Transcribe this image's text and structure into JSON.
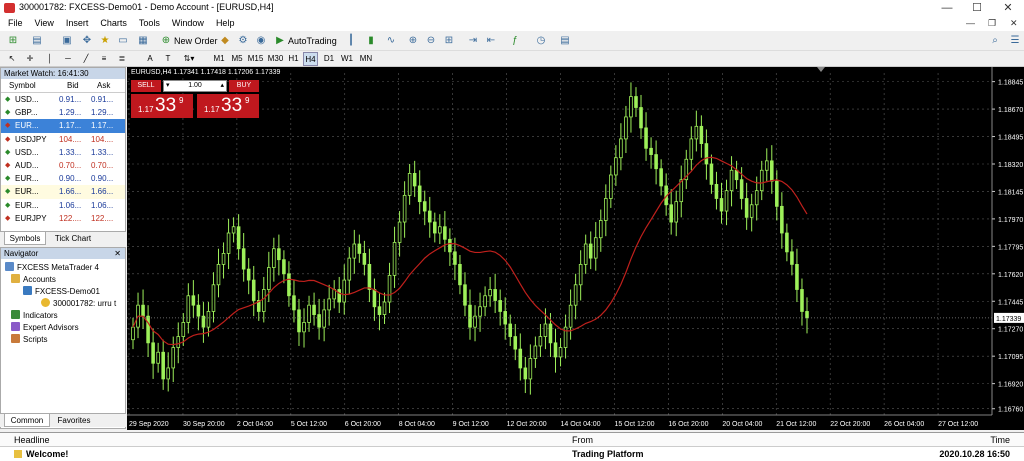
{
  "window": {
    "title": "300001782: FXCESS-Demo01 - Demo Account - [EURUSD,H4]",
    "controls": {
      "minimize": "—",
      "maximize": "☐",
      "close": "✕"
    }
  },
  "menu": [
    "File",
    "View",
    "Insert",
    "Charts",
    "Tools",
    "Window",
    "Help"
  ],
  "menu_right": {
    "minimize": "—",
    "restore": "❐",
    "close": "✕"
  },
  "toolbar": {
    "new_order": "New Order",
    "autotrading": "AutoTrading"
  },
  "timeframes": [
    "M1",
    "M5",
    "M15",
    "M30",
    "H1",
    "H4",
    "D1",
    "W1",
    "MN"
  ],
  "active_timeframe": "H4",
  "market_watch": {
    "title": "Market Watch: 16:41:30",
    "headers": {
      "symbol": "Symbol",
      "bid": "Bid",
      "ask": "Ask"
    },
    "rows": [
      {
        "symbol": "USD...",
        "bid": "0.91...",
        "ask": "0.91...",
        "dir": "up"
      },
      {
        "symbol": "GBP...",
        "bid": "1.29...",
        "ask": "1.29...",
        "dir": "up"
      },
      {
        "symbol": "EUR...",
        "bid": "1.17...",
        "ask": "1.17...",
        "dir": "down",
        "selected": true
      },
      {
        "symbol": "USDJPY",
        "bid": "104....",
        "ask": "104....",
        "dir": "down"
      },
      {
        "symbol": "USD...",
        "bid": "1.33...",
        "ask": "1.33...",
        "dir": "up"
      },
      {
        "symbol": "AUD...",
        "bid": "0.70...",
        "ask": "0.70...",
        "dir": "down"
      },
      {
        "symbol": "EUR...",
        "bid": "0.90...",
        "ask": "0.90...",
        "dir": "up"
      },
      {
        "symbol": "EUR...",
        "bid": "1.66...",
        "ask": "1.66...",
        "dir": "up",
        "highlight": true
      },
      {
        "symbol": "EUR...",
        "bid": "1.06...",
        "ask": "1.06...",
        "dir": "up"
      },
      {
        "symbol": "EURJPY",
        "bid": "122....",
        "ask": "122....",
        "dir": "down"
      }
    ],
    "tabs": [
      "Symbols",
      "Tick Chart"
    ]
  },
  "navigator": {
    "title": "Navigator",
    "root": "FXCESS MetaTrader 4",
    "accounts": "Accounts",
    "server": "FXCESS-Demo01",
    "account": "300001782: urru t",
    "indicators": "Indicators",
    "experts": "Expert Advisors",
    "scripts": "Scripts",
    "tabs": [
      "Common",
      "Favorites"
    ]
  },
  "chart": {
    "label": "EURUSD,H4  1.17341 1.17418 1.17206 1.17339",
    "sell_label": "SELL",
    "buy_label": "BUY",
    "lot": "1.00",
    "sell_price_small": "1.17",
    "sell_price_big": "33",
    "sell_price_sup": "9",
    "buy_price_small": "1.17",
    "buy_price_big": "33",
    "buy_price_sup": "9",
    "current_price": "1.17339",
    "colors": {
      "background": "#000000",
      "candle": "#9ef05a",
      "ma": "#c0201c",
      "grid": "#5a5a5a"
    }
  },
  "chart_data": {
    "type": "candlestick",
    "symbol": "EURUSD",
    "timeframe": "H4",
    "y_ticks": [
      "1.18845",
      "1.18670",
      "1.18495",
      "1.18320",
      "1.18145",
      "1.17970",
      "1.17795",
      "1.17620",
      "1.17445",
      "1.17270",
      "1.17095",
      "1.16920",
      "1.16760"
    ],
    "x_ticks": [
      "29 Sep 2020",
      "30 Sep 20:00",
      "2 Oct 04:00",
      "5 Oct 12:00",
      "6 Oct 20:00",
      "8 Oct 04:00",
      "9 Oct 12:00",
      "12 Oct 20:00",
      "14 Oct 04:00",
      "15 Oct 12:00",
      "16 Oct 20:00",
      "20 Oct 04:00",
      "21 Oct 12:00",
      "22 Oct 20:00",
      "26 Oct 04:00",
      "27 Oct 12:00"
    ],
    "ylim": [
      1.1672,
      1.189
    ],
    "current": 1.17339,
    "closes": [
      1.1728,
      1.1742,
      1.1735,
      1.1718,
      1.1705,
      1.1712,
      1.1695,
      1.1702,
      1.1715,
      1.1722,
      1.1731,
      1.1748,
      1.1742,
      1.1735,
      1.1728,
      1.1738,
      1.1755,
      1.1768,
      1.1775,
      1.1788,
      1.1792,
      1.1778,
      1.1765,
      1.1758,
      1.1745,
      1.1738,
      1.1752,
      1.1766,
      1.1778,
      1.1771,
      1.1762,
      1.1748,
      1.1739,
      1.1725,
      1.1731,
      1.1742,
      1.1736,
      1.1728,
      1.1739,
      1.1746,
      1.1752,
      1.1744,
      1.1758,
      1.1772,
      1.1781,
      1.1775,
      1.1768,
      1.1752,
      1.1741,
      1.1736,
      1.1744,
      1.1761,
      1.1782,
      1.1795,
      1.1812,
      1.1826,
      1.1818,
      1.1808,
      1.1802,
      1.1795,
      1.1788,
      1.1792,
      1.1784,
      1.1776,
      1.1768,
      1.1755,
      1.1742,
      1.1728,
      1.1735,
      1.1741,
      1.1748,
      1.1752,
      1.1745,
      1.1738,
      1.173,
      1.1722,
      1.1714,
      1.1702,
      1.1695,
      1.1708,
      1.1716,
      1.1722,
      1.173,
      1.1718,
      1.1709,
      1.1715,
      1.1728,
      1.1742,
      1.1755,
      1.1768,
      1.1781,
      1.1772,
      1.1785,
      1.1796,
      1.181,
      1.1825,
      1.1836,
      1.1848,
      1.1862,
      1.1875,
      1.1868,
      1.1855,
      1.1842,
      1.1838,
      1.1829,
      1.1818,
      1.1806,
      1.1795,
      1.1808,
      1.1822,
      1.1835,
      1.1848,
      1.1856,
      1.1845,
      1.1832,
      1.1819,
      1.181,
      1.1802,
      1.1815,
      1.1828,
      1.1822,
      1.181,
      1.1798,
      1.1806,
      1.1815,
      1.1828,
      1.1834,
      1.1821,
      1.1805,
      1.1788,
      1.1776,
      1.1768,
      1.1752,
      1.1738,
      1.1734
    ]
  },
  "terminal": {
    "headers": {
      "headline": "Headline",
      "from": "From",
      "time": "Time"
    },
    "rows": [
      {
        "headline": "Welcome!",
        "from": "Trading Platform",
        "time": "2020.10.28 16:50"
      }
    ]
  }
}
